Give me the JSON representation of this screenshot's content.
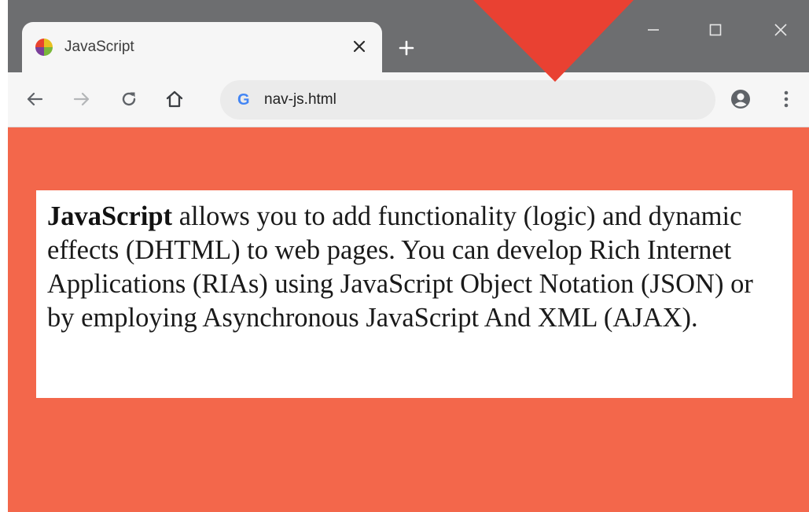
{
  "browser": {
    "tab": {
      "title": "JavaScript",
      "favicon": "javascript-pie-icon",
      "close_icon": "close-icon"
    },
    "new_tab_icon": "plus-icon",
    "window_controls": [
      "minimize-icon",
      "maximize-icon",
      "close-window-icon"
    ],
    "toolbar": {
      "back_icon": "arrow-left-icon",
      "forward_icon": "arrow-right-icon",
      "reload_icon": "reload-icon",
      "home_icon": "home-icon",
      "profile_icon": "account-icon",
      "menu_icon": "kebab-menu-icon"
    },
    "omnibox": {
      "search_badge": "G",
      "url": "nav-js.html"
    }
  },
  "page": {
    "background_color": "#f3674b",
    "paragraph": {
      "bold_lead": "JavaScript",
      "text": " allows you to add functionality (logic) and dynamic effects (DHTML) to web pages. You can develop Rich Internet Applications (RIAs) using JavaScript Object Notation (JSON) or by employing Asynchronous JavaScript And XML (AJAX)."
    }
  },
  "overlay": {
    "pointer_arrow_color": "#e94132",
    "pointer_icon": "down-pointer-arrow-icon"
  },
  "colors": {
    "tabstrip": "#6d6e70",
    "toolbar": "#f6f6f6",
    "omnibox": "#ebebeb",
    "google_blue": "#4285f4"
  }
}
